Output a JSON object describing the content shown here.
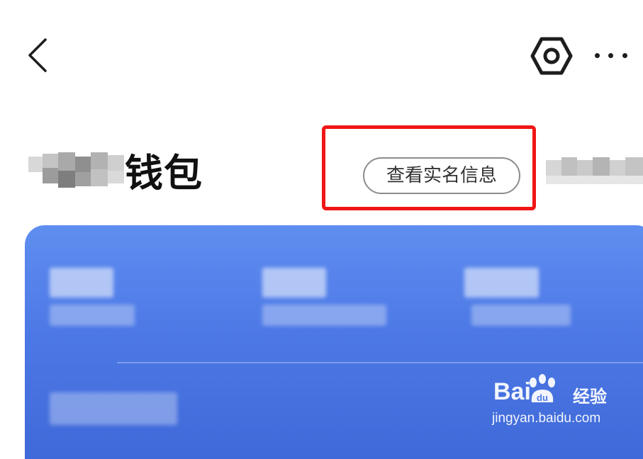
{
  "nav": {
    "back_icon": "chevron-left-icon",
    "settings_icon": "hexagon-settings-icon",
    "more_icon": "more-dots-icon"
  },
  "header": {
    "title": "钱包",
    "realname_button": "查看实名信息"
  },
  "watermark": {
    "brand": "Bai",
    "brand_suffix": "经验",
    "url": "jingyan.baidu.com"
  },
  "colors": {
    "card_top": "#5f8ef0",
    "card_bottom": "#3f69d8",
    "highlight": "#f01616"
  }
}
